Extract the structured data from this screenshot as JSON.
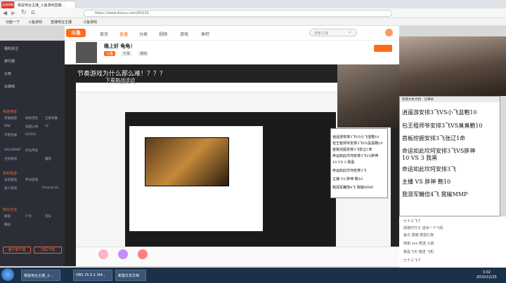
{
  "browser": {
    "badge": "云游戏服",
    "tab_title": "我是电台主播_斗鱼游戏直播...",
    "url": "https://www.douyu.com/65220",
    "bookmarks": [
      "功能一下",
      "斗鱼游戏",
      "直播电台主播",
      "斗鱼游戏"
    ]
  },
  "site": {
    "logo": "斗鱼",
    "nav": [
      "首页",
      "直播",
      "分类",
      "视频",
      "游戏",
      "鱼吧"
    ],
    "search_placeholder": "搜索主播"
  },
  "room": {
    "title": "晚上好 龟龟！",
    "tags": [
      "斗鱼",
      "分享",
      "游戏"
    ],
    "overlay_caption": "节奏游戏为什么那么难！？？？",
    "overlay_sub": "下周挑战活动"
  },
  "sidebar": {
    "sections": [
      {
        "title": "网游竞技",
        "items": [
          "英雄联盟",
          "绝地求生",
          "王者荣耀",
          "DNF",
          "穿越火线",
          "CF",
          "守望先锋",
          "DOTA2",
          "VALORANT",
          "炉石传说",
          "主机游戏",
          "魔兽"
        ]
      },
      {
        "title": "单机热游",
        "items": [
          "主机游戏",
          "怀旧游戏",
          "猎人游戏",
          "Among Us"
        ]
      },
      {
        "title": "娱乐天地",
        "items": [
          "颜值",
          "户外",
          "音乐",
          "舞蹈"
        ]
      }
    ],
    "top_items": [
      "我的关注",
      "排行榜",
      "分类",
      "云游戏"
    ],
    "btn_left": "客户端下载",
    "btn_right": "扫码下载"
  },
  "notepad": {
    "title": "新建文本文档 - 记事本",
    "lines": [
      "逍遥游安排3飞VS小飞韭鞄10",
      "包王租师爷安排3飞VS臭臭鞄10",
      "首板挖掘安排3飞张辽1命",
      "命运如此坎坷安排3飞VS胖神",
      "    10    VS    3    我黑",
      "    命运如此坎坷安排3飞",
      "    主播    VS    胖神    鞄10",
      "  我混军饑倍4飞    我输MMP"
    ]
  },
  "chat": [
    "七十三飞了",
    "感谢叮叮子 送出一个飞机",
    "鱼丸 感谢 赠送礼物",
    "感谢 xxx 赠送 火箭",
    "我是飞天 赠送 飞机",
    "七十三飞了"
  ],
  "taskbar": {
    "tasks": [
      "我是电台主播_斗...",
      "OBS 25.0.1 (64...",
      "新建文本文档"
    ],
    "time": "3:02",
    "date": "2020/12/25"
  }
}
